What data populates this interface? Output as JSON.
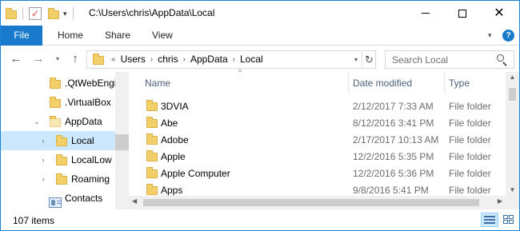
{
  "window": {
    "title": "C:\\Users\\chris\\AppData\\Local",
    "accent_color": "#1979ca"
  },
  "ribbon": {
    "file_tab": "File",
    "tabs": [
      "Home",
      "Share",
      "View"
    ],
    "help_symbol": "?"
  },
  "address": {
    "overflow_symbol": "«",
    "crumbs": [
      "Users",
      "chris",
      "AppData",
      "Local"
    ]
  },
  "search": {
    "placeholder": "Search Local"
  },
  "navpane": {
    "items": [
      {
        "label": ".QtWebEngi",
        "icon": "folder-icon"
      },
      {
        "label": ".VirtualBox",
        "icon": "folder-icon"
      },
      {
        "label": "AppData",
        "icon": "folder-icon",
        "expanded": true
      },
      {
        "label": "Local",
        "icon": "folder-icon",
        "selected": true
      },
      {
        "label": "LocalLow",
        "icon": "folder-icon"
      },
      {
        "label": "Roaming",
        "icon": "folder-icon"
      },
      {
        "label": "Contacts",
        "icon": "contacts-icon"
      }
    ]
  },
  "columns": {
    "name": "Name",
    "date": "Date modified",
    "type": "Type"
  },
  "files": [
    {
      "name": "3DVIA",
      "date": "2/12/2017 7:33 AM",
      "type": "File folder"
    },
    {
      "name": "Abe",
      "date": "8/12/2016 3:41 PM",
      "type": "File folder"
    },
    {
      "name": "Adobe",
      "date": "2/17/2017 10:13 AM",
      "type": "File folder"
    },
    {
      "name": "Apple",
      "date": "12/2/2016 5:35 PM",
      "type": "File folder"
    },
    {
      "name": "Apple Computer",
      "date": "12/2/2016 5:36 PM",
      "type": "File folder"
    },
    {
      "name": "Apps",
      "date": "9/8/2016 5:41 PM",
      "type": "File folder"
    }
  ],
  "status": {
    "item_count": "107 items"
  }
}
